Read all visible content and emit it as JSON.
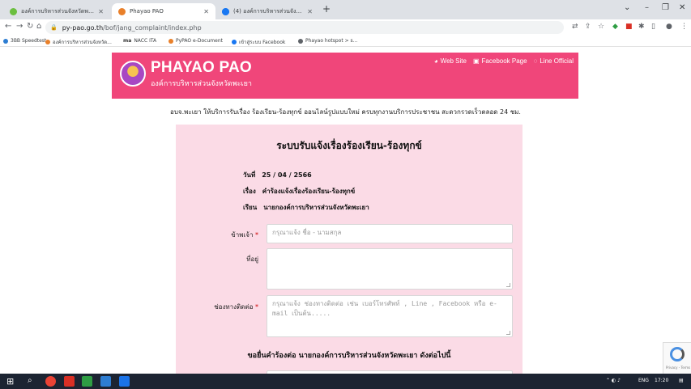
{
  "browser": {
    "tabs": [
      {
        "label": "องค์การบริหารส่วนจังหวัดพะเยา – Ph",
        "fav": "#6cbf3f"
      },
      {
        "label": "Phayao PAO",
        "fav": "#e9802a"
      },
      {
        "label": "(4) องค์การบริหารส่วนจังหวัดพะเยา |",
        "fav": "#1877f2"
      }
    ],
    "new_tab": "+",
    "url_host": "py-pao.go.th",
    "url_path": "/bof/jang_complaint/index.php",
    "bookmarks": [
      {
        "label": "3BB Speedtest",
        "color": "#2d7dd2"
      },
      {
        "label": "องค์การบริหารส่วนจังหวัด...",
        "color": "#e9802a"
      },
      {
        "label": "NACC ITA",
        "color": "#333333",
        "prefix": "ma"
      },
      {
        "label": "PyPAO e-Document",
        "color": "#e9802a"
      },
      {
        "label": "เข้าสู่ระบบ Facebook",
        "color": "#1877f2"
      },
      {
        "label": "Phayao hotspot > s...",
        "color": "#5f6368"
      }
    ]
  },
  "site": {
    "logo_title": "PHAYAO PAO",
    "logo_subtitle": "องค์การบริหารส่วนจังหวัดพะเยา",
    "links": {
      "website": "Web Site",
      "facebook": "Facebook Page",
      "line": "Line Official"
    },
    "notice": "อบจ.พะเยา ให้บริการรับเรื่อง ร้องเรียน-ร้องทุกข์ ออนไลน์รูปแบบใหม่ ครบทุกงานบริการประชาชน สะดวกรวดเร็วตลอด 24 ชม."
  },
  "form": {
    "title": "ระบบรับแจ้งเรื่องร้องเรียน-ร้องทุกข์",
    "date_label": "วันที่",
    "date_value": "25 / 04 / 2566",
    "subject_label": "เรื่อง",
    "subject_value": "คำร้องแจ้งเรื่องร้องเรียน-ร้องทุกข์",
    "to_label": "เรียน",
    "to_value": "นายกองค์การบริหารส่วนจังหวัดพะเยา",
    "name_label": "ข้าพเจ้า",
    "name_placeholder": "กรุณาแจ้ง ชื่อ - นามสกุล",
    "address_label": "ที่อยู่",
    "contact_label": "ช่องทางติดต่อ",
    "contact_placeholder": "กรุณาแจ้ง ช่องทางติดต่อ เช่น เบอร์โทรศัพท์ , Line , Facebook หรือ e-mail เป็นต้น.....",
    "required_mark": "*",
    "subheading": "ขอยื่นคำร้องต่อ นายกองค์การบริหารส่วนจังหวัดพะเยา ดังต่อไปนี้"
  },
  "recaptcha": {
    "text": "Privacy - Terms"
  },
  "taskbar": {
    "lang": "ENG",
    "time": "17:20"
  }
}
